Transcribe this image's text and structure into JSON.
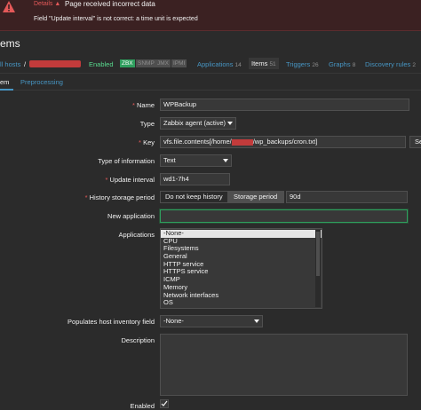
{
  "error": {
    "details_label": "Details ▲",
    "title": "Page received incorrect data",
    "message": "Field \"Update interval\" is not correct: a time unit is expected"
  },
  "page": {
    "title": "ems"
  },
  "host_nav": {
    "all_hosts": "ll hosts",
    "separator": "/",
    "enabled": "Enabled",
    "badges": [
      "ZBX",
      "SNMP",
      "JMX",
      "IPMI"
    ],
    "links": [
      {
        "label": "Applications",
        "count": "14"
      },
      {
        "label": "Items",
        "count": "51"
      },
      {
        "label": "Triggers",
        "count": "26"
      },
      {
        "label": "Graphs",
        "count": "8"
      },
      {
        "label": "Discovery rules",
        "count": "2"
      }
    ]
  },
  "sub_tabs": {
    "item": "em",
    "preprocessing": "Preprocessing"
  },
  "form": {
    "name": {
      "label": "Name",
      "value": "WPBackup"
    },
    "type": {
      "label": "Type",
      "value": "Zabbix agent (active)"
    },
    "key": {
      "label": "Key",
      "value_prefix": "vfs.file.contents[/home/",
      "value_suffix": "/wp_backups/cron.txt]",
      "select_label": "Se"
    },
    "type_info": {
      "label": "Type of information",
      "value": "Text"
    },
    "update_interval": {
      "label": "Update interval",
      "value": "wd1-7h4"
    },
    "history": {
      "label": "History storage period",
      "opt1": "Do not keep history",
      "opt2": "Storage period",
      "value": "90d"
    },
    "new_app": {
      "label": "New application",
      "value": ""
    },
    "applications": {
      "label": "Applications",
      "options": [
        "-None-",
        "CPU",
        "Filesystems",
        "General",
        "HTTP service",
        "HTTPS service",
        "ICMP",
        "Memory",
        "Network interfaces",
        "OS"
      ],
      "selected": "-None-"
    },
    "inventory": {
      "label": "Populates host inventory field",
      "value": "-None-"
    },
    "description": {
      "label": "Description",
      "value": ""
    },
    "enabled": {
      "label": "Enabled",
      "checked": true
    }
  },
  "colors": {
    "accent": "#4796c4",
    "error": "#e45959",
    "enabled": "#59db8f",
    "background": "#2b2b2b"
  }
}
